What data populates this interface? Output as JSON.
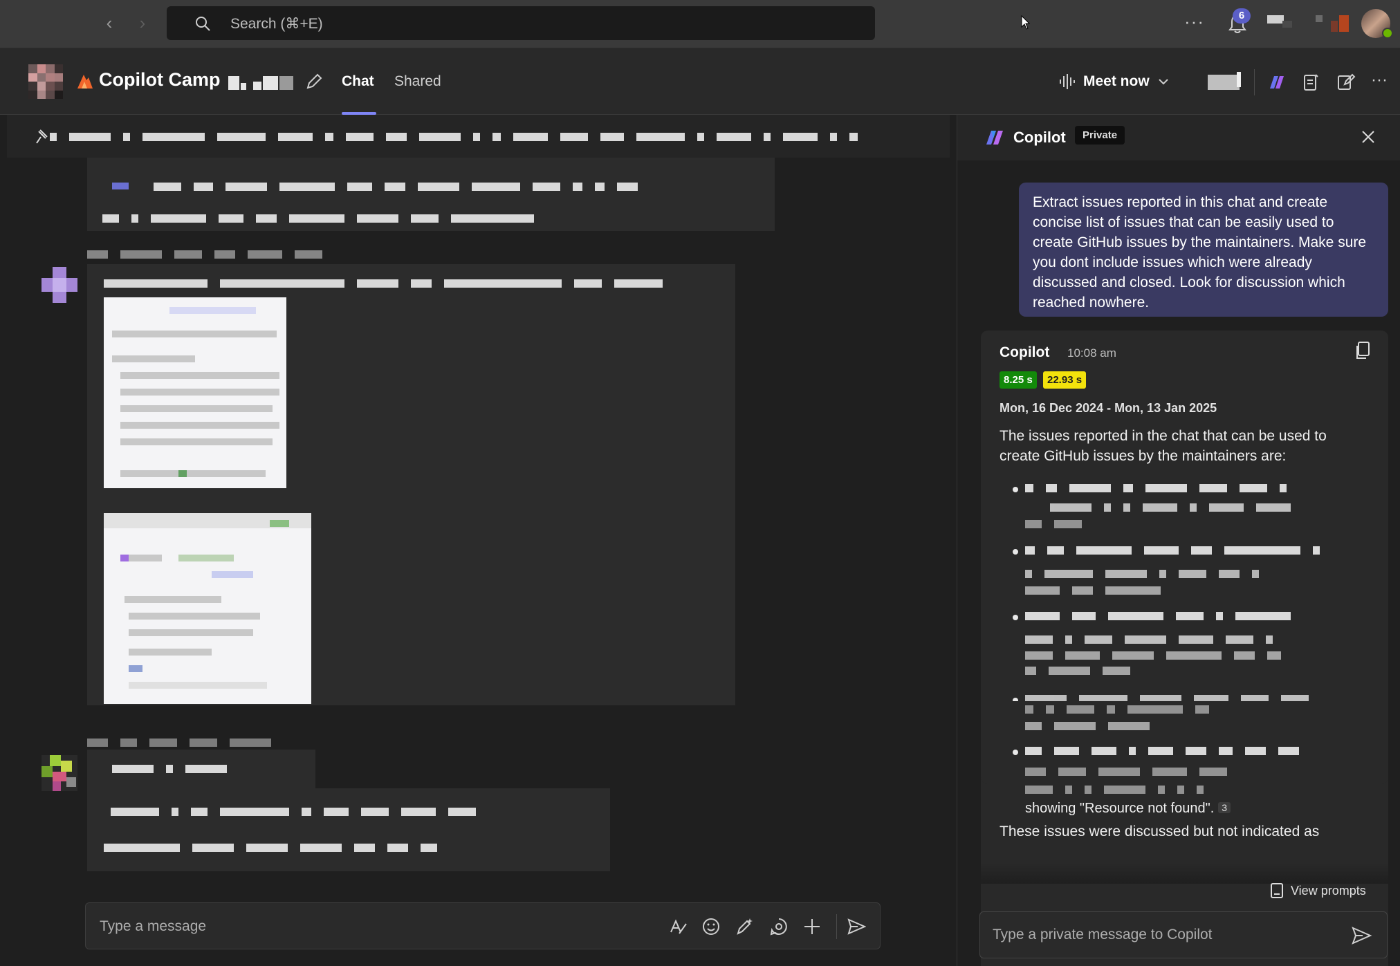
{
  "topbar": {
    "search_placeholder": "Search (⌘+E)",
    "notification_count": "6",
    "more_label": "···"
  },
  "header": {
    "chat_title": "Copilot Camp",
    "tabs": [
      {
        "label": "Chat",
        "active": true
      },
      {
        "label": "Shared",
        "active": false
      }
    ],
    "meet_now_label": "Meet now"
  },
  "composer": {
    "placeholder": "Type a message"
  },
  "copilot": {
    "title": "Copilot",
    "private_label": "Private",
    "user_prompt": "Extract issues reported in this chat and create concise list of issues that can be easily used to create GitHub issues by the maintainers. Make sure you dont include issues which were already discussed and closed. Look for discussion which reached nowhere.",
    "response": {
      "author": "Copilot",
      "time": "10:08 am",
      "badge_fast": "8.25 s",
      "badge_slow": "22.93 s",
      "date_range": "Mon, 16 Dec 2024 - Mon, 13 Jan 2025",
      "intro": "The issues reported in the chat that can be used to create GitHub issues by the maintainers are:",
      "tail_text": "showing \"Resource not found\".",
      "citation": "3",
      "after_text": "These issues were discussed but not indicated as"
    },
    "view_prompts_label": "View prompts",
    "input_placeholder": "Type a private message to Copilot"
  },
  "colors": {
    "accent": "#7f85f5",
    "prompt_bubble": "#3a3a62",
    "badge_green": "#138a0a",
    "badge_yellow": "#f3e20c"
  }
}
